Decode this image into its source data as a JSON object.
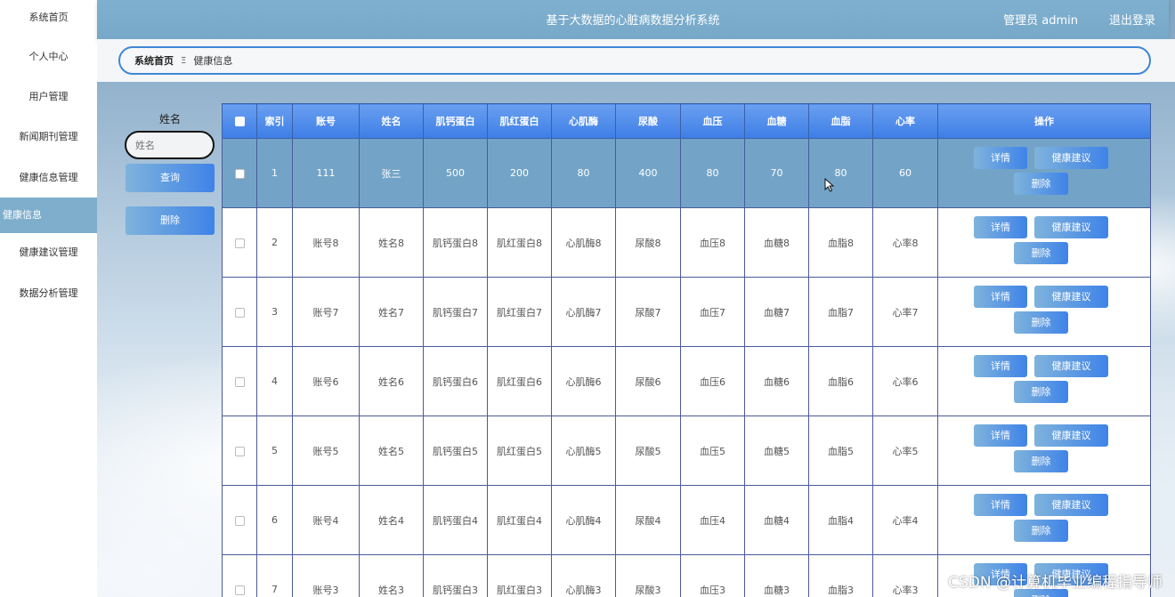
{
  "header": {
    "title": "基于大数据的心脏病数据分析系统",
    "user": "管理员 admin",
    "logout": "退出登录"
  },
  "sidebar": {
    "items": [
      {
        "label": "系统首页"
      },
      {
        "label": "个人中心"
      },
      {
        "label": "用户管理"
      },
      {
        "label": "新闻期刊管理"
      },
      {
        "label": "健康信息管理"
      },
      {
        "label": "健康信息"
      },
      {
        "label": "健康建议管理"
      },
      {
        "label": "数据分析管理"
      }
    ]
  },
  "breadcrumb": {
    "home": "系统首页",
    "separator": "Ξ",
    "current": "健康信息"
  },
  "search": {
    "label": "姓名",
    "placeholder": "姓名",
    "query_label": "查询",
    "delete_label": "删除"
  },
  "table": {
    "columns": [
      "索引",
      "账号",
      "姓名",
      "肌钙蛋白",
      "肌红蛋白",
      "心肌酶",
      "尿酸",
      "血压",
      "血糖",
      "血脂",
      "心率",
      "操作"
    ],
    "rows": [
      [
        "1",
        "111",
        "张三",
        "500",
        "200",
        "80",
        "400",
        "80",
        "70",
        "80",
        "60"
      ],
      [
        "2",
        "账号8",
        "姓名8",
        "肌钙蛋白8",
        "肌红蛋白8",
        "心肌酶8",
        "尿酸8",
        "血压8",
        "血糖8",
        "血脂8",
        "心率8"
      ],
      [
        "3",
        "账号7",
        "姓名7",
        "肌钙蛋白7",
        "肌红蛋白7",
        "心肌酶7",
        "尿酸7",
        "血压7",
        "血糖7",
        "血脂7",
        "心率7"
      ],
      [
        "4",
        "账号6",
        "姓名6",
        "肌钙蛋白6",
        "肌红蛋白6",
        "心肌酶6",
        "尿酸6",
        "血压6",
        "血糖6",
        "血脂6",
        "心率6"
      ],
      [
        "5",
        "账号5",
        "姓名5",
        "肌钙蛋白5",
        "肌红蛋白5",
        "心肌酶5",
        "尿酸5",
        "血压5",
        "血糖5",
        "血脂5",
        "心率5"
      ],
      [
        "6",
        "账号4",
        "姓名4",
        "肌钙蛋白4",
        "肌红蛋白4",
        "心肌酶4",
        "尿酸4",
        "血压4",
        "血糖4",
        "血脂4",
        "心率4"
      ],
      [
        "7",
        "账号3",
        "姓名3",
        "肌钙蛋白3",
        "肌红蛋白3",
        "心肌酶3",
        "尿酸3",
        "血压3",
        "血糖3",
        "血脂3",
        "心率3"
      ]
    ],
    "actions": {
      "detail": "详情",
      "advice": "健康建议",
      "delete": "删除"
    }
  },
  "watermark": "CSDN @计算机毕业编程指导师",
  "colors": {
    "header_bg": "#77a8c8",
    "active_sidebar": "#7eaecc",
    "button_gradient_start": "#7fb3dc",
    "button_gradient_end": "#3f83e8",
    "table_header": "#3d7ee6",
    "selected_row": "#73a4c8"
  }
}
